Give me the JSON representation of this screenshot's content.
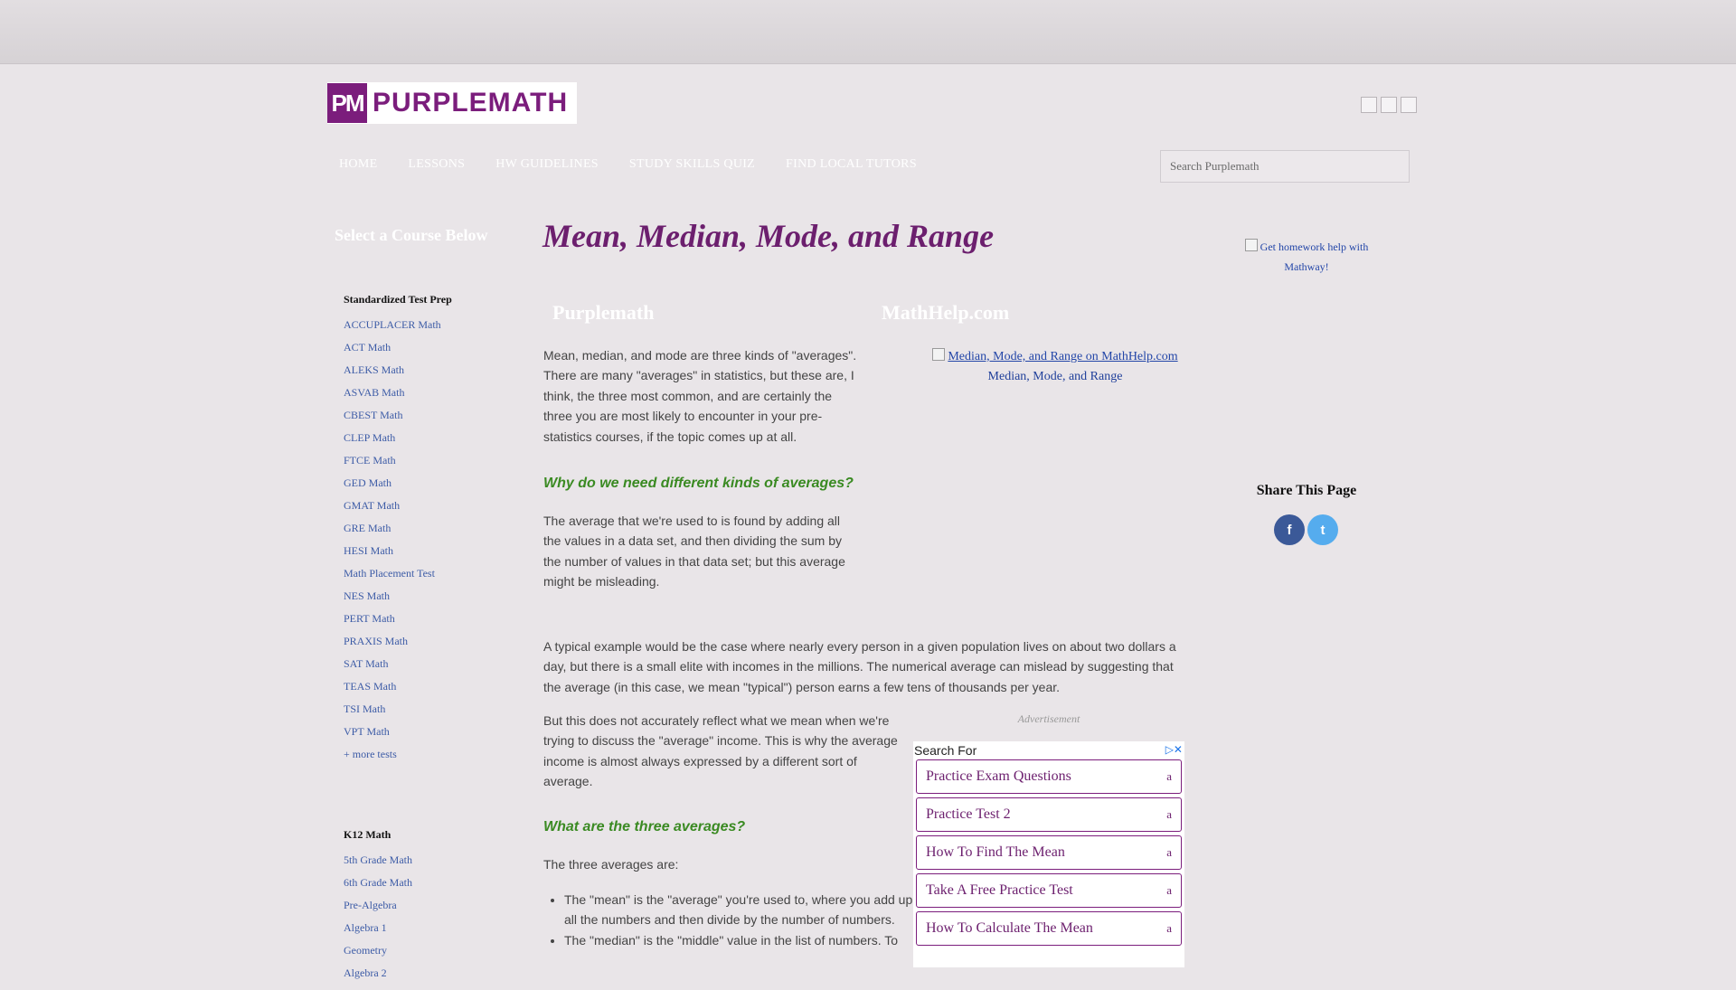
{
  "header": {
    "logo_mark": "PM",
    "logo_text": "PURPLEMATH",
    "nav": [
      "HOME",
      "LESSONS",
      "HW GUIDELINES",
      "STUDY SKILLS QUIZ",
      "FIND LOCAL TUTORS"
    ],
    "search_placeholder": "Search Purplemath"
  },
  "sidebar": {
    "title": "Select a Course Below",
    "groups": [
      {
        "heading": "Standardized Test Prep",
        "items": [
          "ACCUPLACER Math",
          "ACT Math",
          "ALEKS Math",
          "ASVAB Math",
          "CBEST Math",
          "CLEP Math",
          "FTCE Math",
          "GED Math",
          "GMAT Math",
          "GRE Math",
          "HESI Math",
          "Math Placement Test",
          "NES Math",
          "PERT Math",
          "PRAXIS Math",
          "SAT Math",
          "TEAS Math",
          "TSI Math",
          "VPT Math",
          "+ more tests"
        ]
      },
      {
        "heading": "K12 Math",
        "items": [
          "5th Grade Math",
          "6th Grade Math",
          "Pre-Algebra",
          "Algebra 1",
          "Geometry",
          "Algebra 2"
        ]
      }
    ]
  },
  "main": {
    "title": "Mean, Median, Mode, and Range",
    "col_left_heading": "Purplemath",
    "col_right_heading": "MathHelp.com",
    "mathhelp_link_alt": "Median, Mode, and Range on MathHelp.com",
    "mathhelp_caption": "Median, Mode, and Range",
    "intro": "Mean, median, and mode are three kinds of \"averages\". There are many \"averages\" in statistics, but these are, I think, the three most common, and are certainly the three you are most likely to encounter in your pre-statistics courses, if the topic comes up at all.",
    "subhead_1": "Why do we need different kinds of averages?",
    "para_2": "The average that we're used to is found by adding all the values in a data set, and then dividing the sum by the number of values in that data set; but this average might be misleading.",
    "para_3": "A typical example would be the case where nearly every person in a given population lives on about two dollars a day, but there is a small elite with incomes in the millions. The numerical average can mislead by suggesting that the average (in this case, we mean \"typical\") person earns a few tens of thousands per year.",
    "para_4": "But this does not accurately reflect what we mean when we're trying to discuss the \"average\" income. This is why the average income is almost always expressed by a different sort of average.",
    "subhead_2": "What are the three averages?",
    "para_5": "The three averages are:",
    "bullets": [
      "The \"mean\" is the \"average\" you're used to, where you add up all the numbers and then divide by the number of numbers.",
      "The \"median\" is the \"middle\" value in the list of numbers. To"
    ]
  },
  "ad": {
    "label": "Advertisement",
    "search_for": "Search For",
    "items": [
      "Practice Exam Questions",
      "Practice Test 2",
      "How To Find The Mean",
      "Take A Free Practice Test",
      "How To Calculate The Mean"
    ],
    "item_chevron": "a"
  },
  "right": {
    "mathway_text": "Get homework help with Mathway!",
    "share_title": "Share This Page",
    "share_buttons": [
      "f",
      "t"
    ]
  },
  "colors": {
    "brand_purple": "#7b1d7c",
    "subhead_green": "#3a8a22",
    "link_blue": "#3c5ba6",
    "facebook": "#3b5998",
    "twitter": "#55acee"
  }
}
